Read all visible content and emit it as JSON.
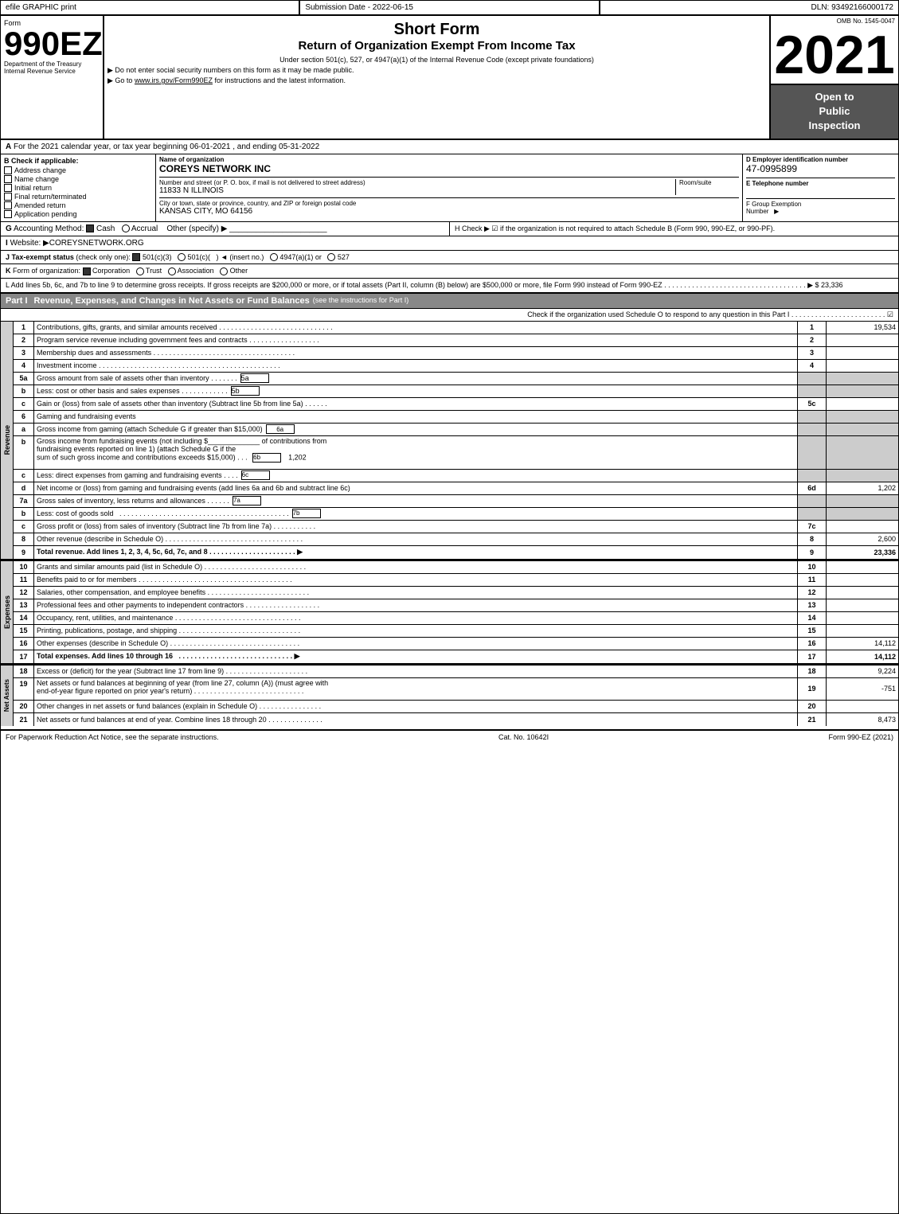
{
  "topBar": {
    "left": "efile GRAPHIC print",
    "mid": "Submission Date - 2022-06-15",
    "right": "DLN: 93492166000172"
  },
  "form": {
    "number": "990EZ",
    "ombNumber": "OMB No. 1545-0047",
    "shortFormTitle": "Short Form",
    "mainTitle": "Return of Organization Exempt From Income Tax",
    "underSection": "Under section 501(c), 527, or 4947(a)(1) of the Internal Revenue Code (except private foundations)",
    "noSSN": "▶ Do not enter social security numbers on this form as it may be made public.",
    "goTo": "▶ Go to www.irs.gov/Form990EZ for instructions and the latest information.",
    "year": "2021",
    "openToPublic": "Open to\nPublic\nInspection",
    "deptLabel": "Department of the Treasury",
    "irsLabel": "Internal Revenue Service"
  },
  "sectionA": {
    "label": "A",
    "text": "For the 2021 calendar year, or tax year beginning 06-01-2021 , and ending 05-31-2022"
  },
  "sectionB": {
    "label": "B Check if applicable:",
    "checks": [
      {
        "label": "Address change",
        "checked": false
      },
      {
        "label": "Name change",
        "checked": false
      },
      {
        "label": "Initial return",
        "checked": false
      },
      {
        "label": "Final return/terminated",
        "checked": false
      },
      {
        "label": "Amended return",
        "checked": false
      },
      {
        "label": "Application pending",
        "checked": false
      }
    ]
  },
  "sectionC": {
    "label": "C",
    "nameLabel": "Name of organization",
    "orgName": "COREYS NETWORK INC",
    "addressLabel": "Number and street (or P. O. box, if mail is not delivered to street address)",
    "address": "11833 N ILLINOIS",
    "roomLabel": "Room/suite",
    "cityLabel": "City or town, state or province, country, and ZIP or foreign postal code",
    "city": "KANSAS CITY, MO  64156"
  },
  "sectionD": {
    "label": "D Employer identification number",
    "ein": "47-0995899",
    "telLabel": "E Telephone number",
    "telValue": "",
    "groupLabel": "F Group Exemption Number",
    "groupArrow": "▶"
  },
  "sectionG": {
    "label": "G",
    "text": "Accounting Method:",
    "cashLabel": "Cash",
    "cashChecked": true,
    "accrualLabel": "Accrual",
    "accrualChecked": false,
    "otherLabel": "Other (specify) ▶",
    "otherLine": "_______________",
    "hText": "H  Check ▶  ☑ if the organization is not required to attach Schedule B (Form 990, 990-EZ, or 990-PF)."
  },
  "sectionI": {
    "label": "I",
    "text": "Website: ▶COREYSNETWORK.ORG"
  },
  "sectionJ": {
    "label": "J",
    "text": "Tax-exempt status (check only one): ☑ 501(c)(3)  ○ 501(c)(   ) ◄ (insert no.)  ○ 4947(a)(1) or  ○ 527"
  },
  "sectionK": {
    "label": "K",
    "text": "Form of organization: ☑ Corporation   ○ Trust   ○ Association   ○ Other"
  },
  "sectionL": {
    "text": "L Add lines 5b, 6c, and 7b to line 9 to determine gross receipts. If gross receipts are $200,000 or more, or if total assets (Part II, column (B) below) are $500,000 or more, file Form 990 instead of Form 990-EZ . . . . . . . . . . . . . . . . . . . . . . . . . . . . . . . . . . . . ▶ $ 23,336"
  },
  "partI": {
    "label": "Part I",
    "title": "Revenue, Expenses, and Changes in Net Assets or Fund Balances",
    "seeInstructions": "(see the instructions for Part I)",
    "checkScheduleO": "Check if the organization used Schedule O to respond to any question in this Part I . . . . . . . . . . . . . . . . . . . . . . . . ☑",
    "lines": [
      {
        "num": "1",
        "desc": "Contributions, gifts, grants, and similar amounts received",
        "dots": true,
        "refNum": "1",
        "value": "19,534",
        "shaded": false
      },
      {
        "num": "2",
        "desc": "Program service revenue including government fees and contracts",
        "dots": true,
        "refNum": "2",
        "value": "",
        "shaded": false
      },
      {
        "num": "3",
        "desc": "Membership dues and assessments",
        "dots": true,
        "refNum": "3",
        "value": "",
        "shaded": false
      },
      {
        "num": "4",
        "desc": "Investment income",
        "dots": true,
        "refNum": "4",
        "value": "",
        "shaded": false
      },
      {
        "num": "5a",
        "desc": "Gross amount from sale of assets other than inventory . . . . . . .",
        "refNum": "5a",
        "value": "",
        "shaded": false,
        "subBox": true
      },
      {
        "num": "b",
        "desc": "Less: cost or other basis and sales expenses . . . . . . . . . .",
        "refNum": "5b",
        "value": "",
        "shaded": false,
        "subBox": true
      },
      {
        "num": "c",
        "desc": "Gain or (loss) from sale of assets other than inventory (Subtract line 5b from line 5a) . . . . . .",
        "refNum": "5c",
        "value": "",
        "shaded": false
      },
      {
        "num": "6",
        "desc": "Gaming and fundraising events",
        "refNum": "",
        "value": "",
        "shaded": false,
        "header": true
      }
    ]
  },
  "revenueLines": [
    {
      "num": "a",
      "desc": "Gross income from gaming (attach Schedule G if greater than $15,000)",
      "refNum": "6a",
      "value": "",
      "shaded": false,
      "subBox": true
    },
    {
      "num": "b",
      "desc": "Gross income from fundraising events (not including $_____________ of contributions from fundraising events reported on line 1) (attach Schedule G if the sum of such gross income and contributions exceeds $15,000) . . .",
      "refNum": "6b",
      "value": "1,202",
      "shaded": false,
      "subBox": true
    },
    {
      "num": "c",
      "desc": "Less: direct expenses from gaming and fundraising events . . . .",
      "refNum": "6c",
      "value": "",
      "shaded": false,
      "subBox": true
    },
    {
      "num": "d",
      "desc": "Net income or (loss) from gaming and fundraising events (add lines 6a and 6b and subtract line 6c)",
      "refNum": "6d",
      "value": "1,202",
      "shaded": false
    },
    {
      "num": "7a",
      "desc": "Gross sales of inventory, less returns and allowances . . . . . .",
      "refNum": "7a",
      "value": "",
      "shaded": false,
      "subBox": true
    },
    {
      "num": "b",
      "desc": "Less: cost of goods sold . . . . . . . . . . . . . . . . . . . . .",
      "refNum": "7b",
      "value": "",
      "shaded": false,
      "subBox": true
    },
    {
      "num": "c",
      "desc": "Gross profit or (loss) from sales of inventory (Subtract line 7b from line 7a) . . . . . . . . . .",
      "refNum": "7c",
      "value": "",
      "shaded": false
    },
    {
      "num": "8",
      "desc": "Other revenue (describe in Schedule O) . . . . . . . . . . . . . . . . . . . . . . . . . . . . . .",
      "refNum": "8",
      "value": "2,600",
      "shaded": false
    },
    {
      "num": "9",
      "desc": "Total revenue. Add lines 1, 2, 3, 4, 5c, 6d, 7c, and 8 . . . . . . . . . . . . . . . . . . . . . .",
      "refNum": "9",
      "value": "23,336",
      "shaded": false,
      "bold": true,
      "arrow": true
    }
  ],
  "expenseLines": [
    {
      "num": "10",
      "desc": "Grants and similar amounts paid (list in Schedule O) . . . . . . . . . . . . . . . . . . . . . . .",
      "refNum": "10",
      "value": "",
      "shaded": false
    },
    {
      "num": "11",
      "desc": "Benefits paid to or for members . . . . . . . . . . . . . . . . . . . . . . . . . . . . . . . . . .",
      "refNum": "11",
      "value": "",
      "shaded": false
    },
    {
      "num": "12",
      "desc": "Salaries, other compensation, and employee benefits . . . . . . . . . . . . . . . . . . . . . . .",
      "refNum": "12",
      "value": "",
      "shaded": false
    },
    {
      "num": "13",
      "desc": "Professional fees and other payments to independent contractors . . . . . . . . . . . . . . . . .",
      "refNum": "13",
      "value": "",
      "shaded": false
    },
    {
      "num": "14",
      "desc": "Occupancy, rent, utilities, and maintenance . . . . . . . . . . . . . . . . . . . . . . . . . . . .",
      "refNum": "14",
      "value": "",
      "shaded": false
    },
    {
      "num": "15",
      "desc": "Printing, publications, postage, and shipping . . . . . . . . . . . . . . . . . . . . . . . . . . .",
      "refNum": "15",
      "value": "",
      "shaded": false
    },
    {
      "num": "16",
      "desc": "Other expenses (describe in Schedule O) . . . . . . . . . . . . . . . . . . . . . . . . . . . . .",
      "refNum": "16",
      "value": "14,112",
      "shaded": false
    },
    {
      "num": "17",
      "desc": "Total expenses. Add lines 10 through 16 . . . . . . . . . . . . . . . . . . . . . . . . . . . .",
      "refNum": "17",
      "value": "14,112",
      "shaded": false,
      "bold": true,
      "arrow": true
    }
  ],
  "netAssetLines": [
    {
      "num": "18",
      "desc": "Excess or (deficit) for the year (Subtract line 17 from line 9) . . . . . . . . . . . . . . . . . .",
      "refNum": "18",
      "value": "9,224",
      "shaded": false
    },
    {
      "num": "19",
      "desc": "Net assets or fund balances at beginning of year (from line 27, column (A)) (must agree with end-of-year figure reported on prior year's return) . . . . . . . . . . . . . . . . . . . . . . . .",
      "refNum": "19",
      "value": "-751",
      "shaded": false
    },
    {
      "num": "20",
      "desc": "Other changes in net assets or fund balances (explain in Schedule O) . . . . . . . . . . . . . .",
      "refNum": "20",
      "value": "",
      "shaded": false
    },
    {
      "num": "21",
      "desc": "Net assets or fund balances at end of year. Combine lines 18 through 20 . . . . . . . . . . . . .",
      "refNum": "21",
      "value": "8,473",
      "shaded": false
    }
  ],
  "footer": {
    "paperwork": "For Paperwork Reduction Act Notice, see the separate instructions.",
    "catNo": "Cat. No. 10642I",
    "formLabel": "Form 990-EZ (2021)"
  }
}
